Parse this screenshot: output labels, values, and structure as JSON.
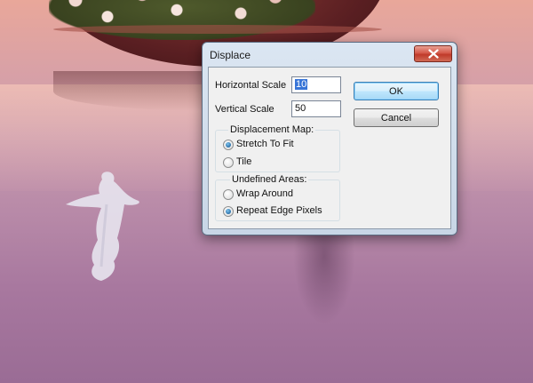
{
  "dialog": {
    "title": "Displace",
    "horizontal_scale": {
      "label": "Horizontal Scale",
      "value": "10"
    },
    "vertical_scale": {
      "label": "Vertical Scale",
      "value": "50"
    },
    "ok_label": "OK",
    "cancel_label": "Cancel",
    "displacement_map": {
      "title": "Displacement Map:",
      "options": [
        {
          "label": "Stretch To Fit",
          "selected": true
        },
        {
          "label": "Tile",
          "selected": false
        }
      ]
    },
    "undefined_areas": {
      "title": "Undefined Areas:",
      "options": [
        {
          "label": "Wrap Around",
          "selected": false
        },
        {
          "label": "Repeat Edge Pixels",
          "selected": true
        }
      ]
    }
  },
  "icons": {
    "close": "close-x-icon"
  },
  "colors": {
    "close_button": "#c8453a",
    "default_button_border": "#3c7fb1",
    "selection": "#3875d7"
  }
}
